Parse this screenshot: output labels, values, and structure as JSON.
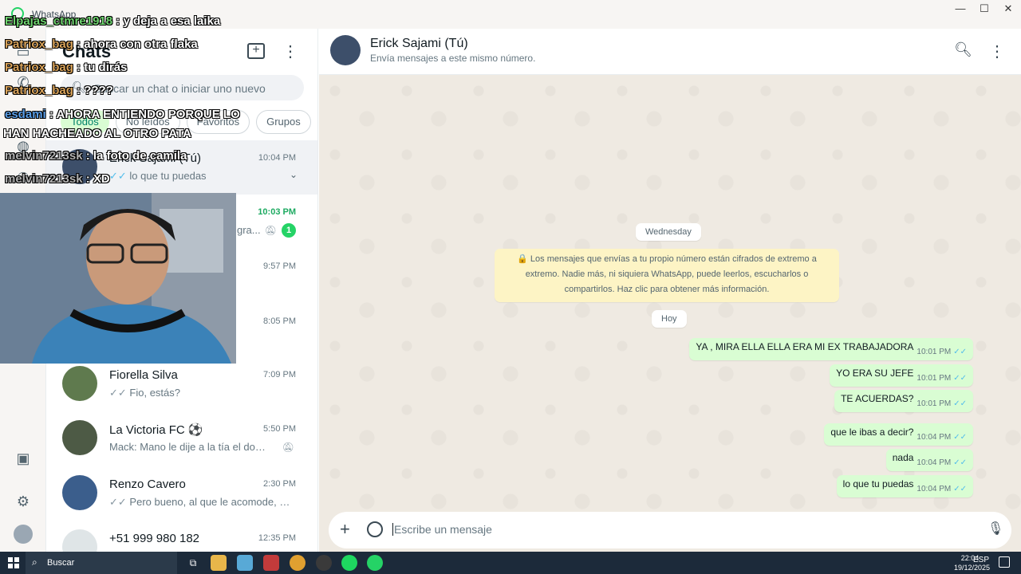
{
  "window": {
    "app_name": "WhatsApp",
    "controls": [
      "—",
      "☐",
      "✕"
    ]
  },
  "chat_list": {
    "title": "Chats",
    "search_placeholder": "Buscar un chat o iniciar uno nuevo",
    "filters": [
      {
        "label": "Todos",
        "active": true
      },
      {
        "label": "No leídos",
        "active": false
      },
      {
        "label": "Favoritos",
        "active": false
      },
      {
        "label": "Grupos",
        "active": false
      }
    ],
    "chats": [
      {
        "name": "Erick Sajami (Tú)",
        "time": "10:04 PM",
        "preview": "lo que tu puedas",
        "ticks": "✓✓",
        "selected": true
      },
      {
        "name": "",
        "time": "10:03 PM",
        "preview": "gra...",
        "unread": "1",
        "muted": true
      },
      {
        "name": "",
        "time": "9:57 PM",
        "preview": ""
      },
      {
        "name": "",
        "time": "8:05 PM",
        "preview": ""
      },
      {
        "name": "Fiorella Silva",
        "time": "7:09 PM",
        "preview": "Fio, estás?",
        "ticks": "✓✓"
      },
      {
        "name": "La Victoria FC ⚽",
        "time": "5:50 PM",
        "preview": "Mack: Mano le dije a la tía el domin...",
        "muted": true
      },
      {
        "name": "Renzo Cavero",
        "time": "2:30 PM",
        "preview": "Pero bueno, al que le acomode, geni...",
        "ticks": "✓✓"
      },
      {
        "name": "+51 999 980 182",
        "time": "12:35 PM",
        "preview": ""
      }
    ]
  },
  "chat": {
    "contact_name": "Erick Sajami (Tú)",
    "contact_subtitle": "Envía mensajes a este mismo número.",
    "date_wednesday": "Wednesday",
    "encryption_note": "🔒 Los mensajes que envías a tu propio número están cifrados de extremo a extremo. Nadie más, ni siquiera WhatsApp, puede leerlos, escucharlos o compartirlos. Haz clic para obtener más información.",
    "date_today": "Hoy",
    "messages": [
      {
        "text": "YA , MIRA ELLA ELLA ERA MI EX TRABAJADORA",
        "time": "10:01 PM"
      },
      {
        "text": "YO ERA SU JEFE",
        "time": "10:01 PM"
      },
      {
        "text": "TE ACUERDAS?",
        "time": "10:01 PM"
      },
      {
        "text": "que le ibas a decir?",
        "time": "10:04 PM"
      },
      {
        "text": "nada",
        "time": "10:04 PM"
      },
      {
        "text": "lo que tu puedas",
        "time": "10:04 PM"
      }
    ],
    "composer_placeholder": "Escribe un mensaje"
  },
  "stream_chat": [
    {
      "user": "Elpajas_ctmre1918",
      "msg": " : y deja a esa laika",
      "color": "green"
    },
    {
      "user": "Patriox_bag",
      "msg": " : ahora con otra flaka",
      "color": "orange"
    },
    {
      "user": "Patriox_bag",
      "msg": " : tu dirás",
      "color": "orange"
    },
    {
      "user": "Patriox_bag",
      "msg": " : ????",
      "color": "orange"
    },
    {
      "user": "esdami",
      "msg": " : AHORA ENTIENDO PORQUE LO",
      "color": "blue"
    },
    {
      "user": "",
      "msg": "HAN HACHEADO AL OTRO PATA",
      "color": "blue"
    },
    {
      "user": "melvin7213sk",
      "msg": " : la foto de camila",
      "color": "grey"
    },
    {
      "user": "melvin7213sk",
      "msg": " : XD",
      "color": "grey"
    }
  ],
  "taskbar": {
    "search_label": "Buscar",
    "tray_lang": "ESP",
    "clock_time": "22:04",
    "clock_date": "19/12/2025"
  },
  "colors": {
    "accent": "#25d366",
    "bubble_out": "#d9fdd3",
    "chat_bg": "#efeae2",
    "read_tick": "#53bdeb"
  }
}
